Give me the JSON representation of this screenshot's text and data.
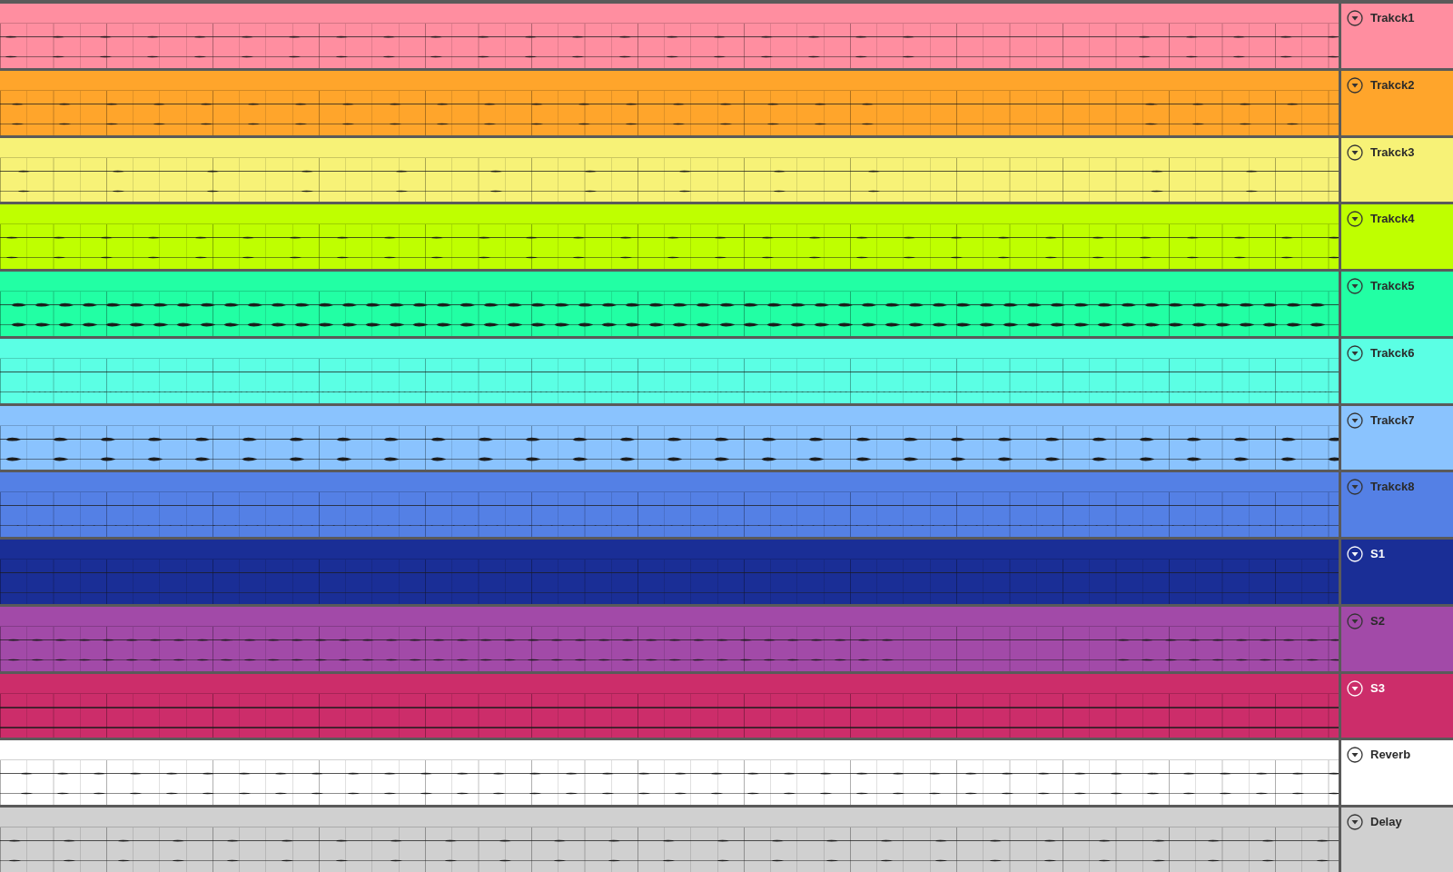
{
  "tracks": [
    {
      "name": "Trakck1",
      "color": "#ff8ea0"
    },
    {
      "name": "Trakck2",
      "color": "#ffa52b"
    },
    {
      "name": "Trakck3",
      "color": "#f7f277"
    },
    {
      "name": "Trakck4",
      "color": "#bfff00"
    },
    {
      "name": "Trakck5",
      "color": "#22ffa4"
    },
    {
      "name": "Trakck6",
      "color": "#5bffe4"
    },
    {
      "name": "Trakck7",
      "color": "#8ac3fe"
    },
    {
      "name": "Trakck8",
      "color": "#5480e5"
    },
    {
      "name": "S1",
      "color": "#1a2e96"
    },
    {
      "name": "S2",
      "color": "#a24aa8"
    },
    {
      "name": "S3",
      "color": "#cc2d6a"
    },
    {
      "name": "Reverb",
      "color": "#ffffff"
    },
    {
      "name": "Delay",
      "color": "#d0d0d0"
    }
  ]
}
